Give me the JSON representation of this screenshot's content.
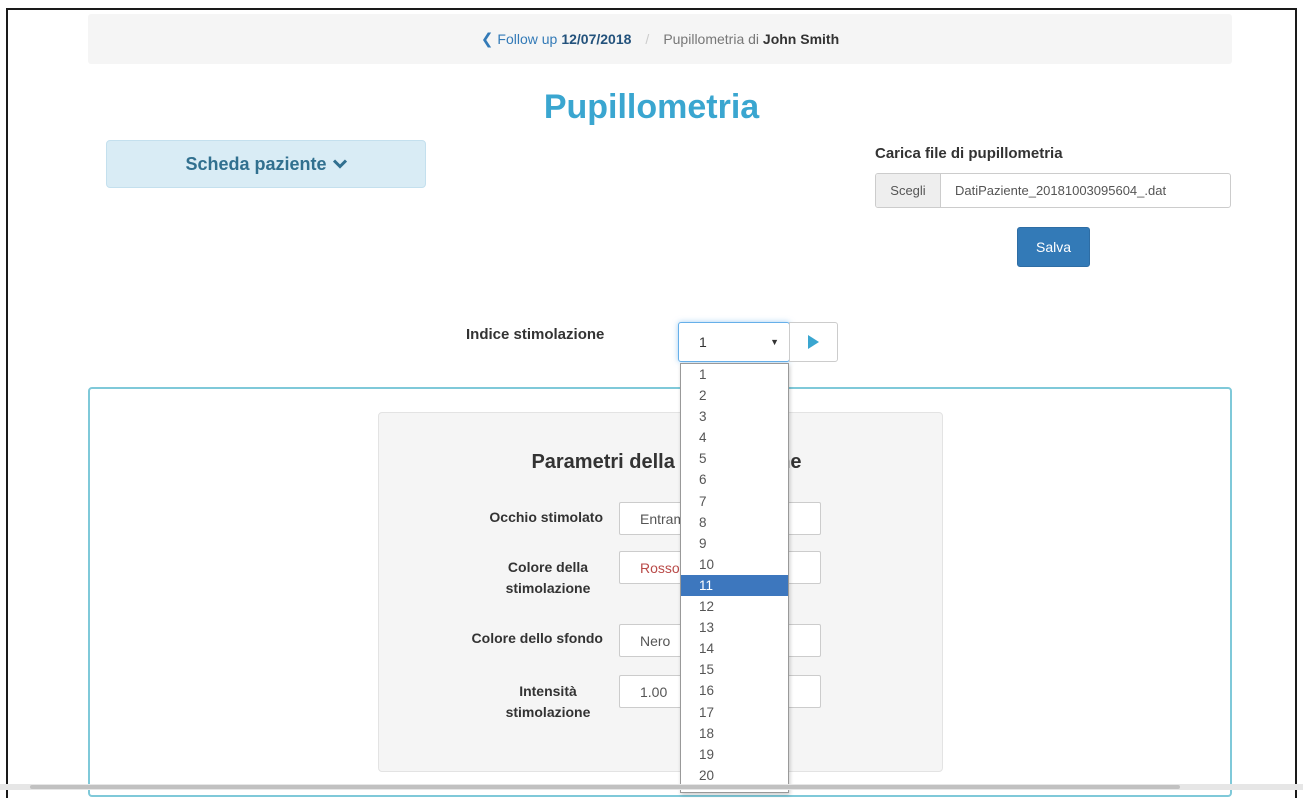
{
  "breadcrumb": {
    "back_prefix": "Follow up",
    "back_date": "12/07/2018",
    "separator": "/",
    "current_prefix": "Pupillometria di",
    "current_name": "John Smith"
  },
  "page_title": "Pupillometria",
  "patient_button": {
    "label": "Scheda paziente"
  },
  "upload": {
    "label": "Carica file di pupillometria",
    "choose_label": "Scegli",
    "file_name": "DatiPaziente_20181003095604_.dat",
    "save_label": "Salva"
  },
  "stimulation": {
    "label": "Indice stimolazione",
    "selected": "1",
    "options": [
      "1",
      "2",
      "3",
      "4",
      "5",
      "6",
      "7",
      "8",
      "9",
      "10",
      "11",
      "12",
      "13",
      "14",
      "15",
      "16",
      "17",
      "18",
      "19",
      "20"
    ],
    "highlighted_option": "11"
  },
  "params": {
    "title": "Parametri della stimolazione",
    "fields": [
      {
        "label": "Occhio stimolato",
        "value": "Entrambi"
      },
      {
        "label": "Colore della stimolazione",
        "value": "Rosso"
      },
      {
        "label": "Colore dello sfondo",
        "value": "Nero"
      },
      {
        "label": "Intensità stimolazione",
        "value": "1.00"
      }
    ]
  },
  "colors": {
    "accent": "#3aa6d0",
    "primary_button": "#337ab7",
    "selected_option": "#3d77be",
    "panel_border": "#7fc9d9"
  }
}
